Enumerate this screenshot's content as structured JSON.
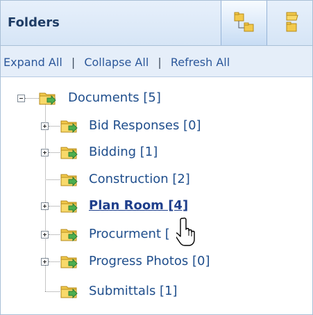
{
  "header": {
    "title": "Folders",
    "buttons": [
      {
        "icon": "folder-tree-icon",
        "active": true
      },
      {
        "icon": "folder-list-icon",
        "active": false
      }
    ]
  },
  "actions": {
    "expand_all": "Expand All",
    "collapse_all": "Collapse All",
    "refresh_all": "Refresh All",
    "separator": "|"
  },
  "tree": {
    "root": {
      "label": "Documents [5]",
      "expanded": true
    },
    "children": [
      {
        "label": "Bid Responses [0]",
        "expandable": true
      },
      {
        "label": "Bidding [1]",
        "expandable": true
      },
      {
        "label": "Construction [2]",
        "expandable": false
      },
      {
        "label": "Plan Room [4]",
        "expandable": true,
        "selected": true
      },
      {
        "label": "Procurment [",
        "expandable": true
      },
      {
        "label": "Progress Photos [0]",
        "expandable": true
      },
      {
        "label": "Submittals [1]",
        "expandable": false
      }
    ]
  },
  "colors": {
    "link": "#2b579a",
    "tree_text": "#1f4e8c",
    "header_text": "#1f3d66",
    "folder_yellow": "#f2c94c",
    "arrow_green": "#4caf50"
  }
}
